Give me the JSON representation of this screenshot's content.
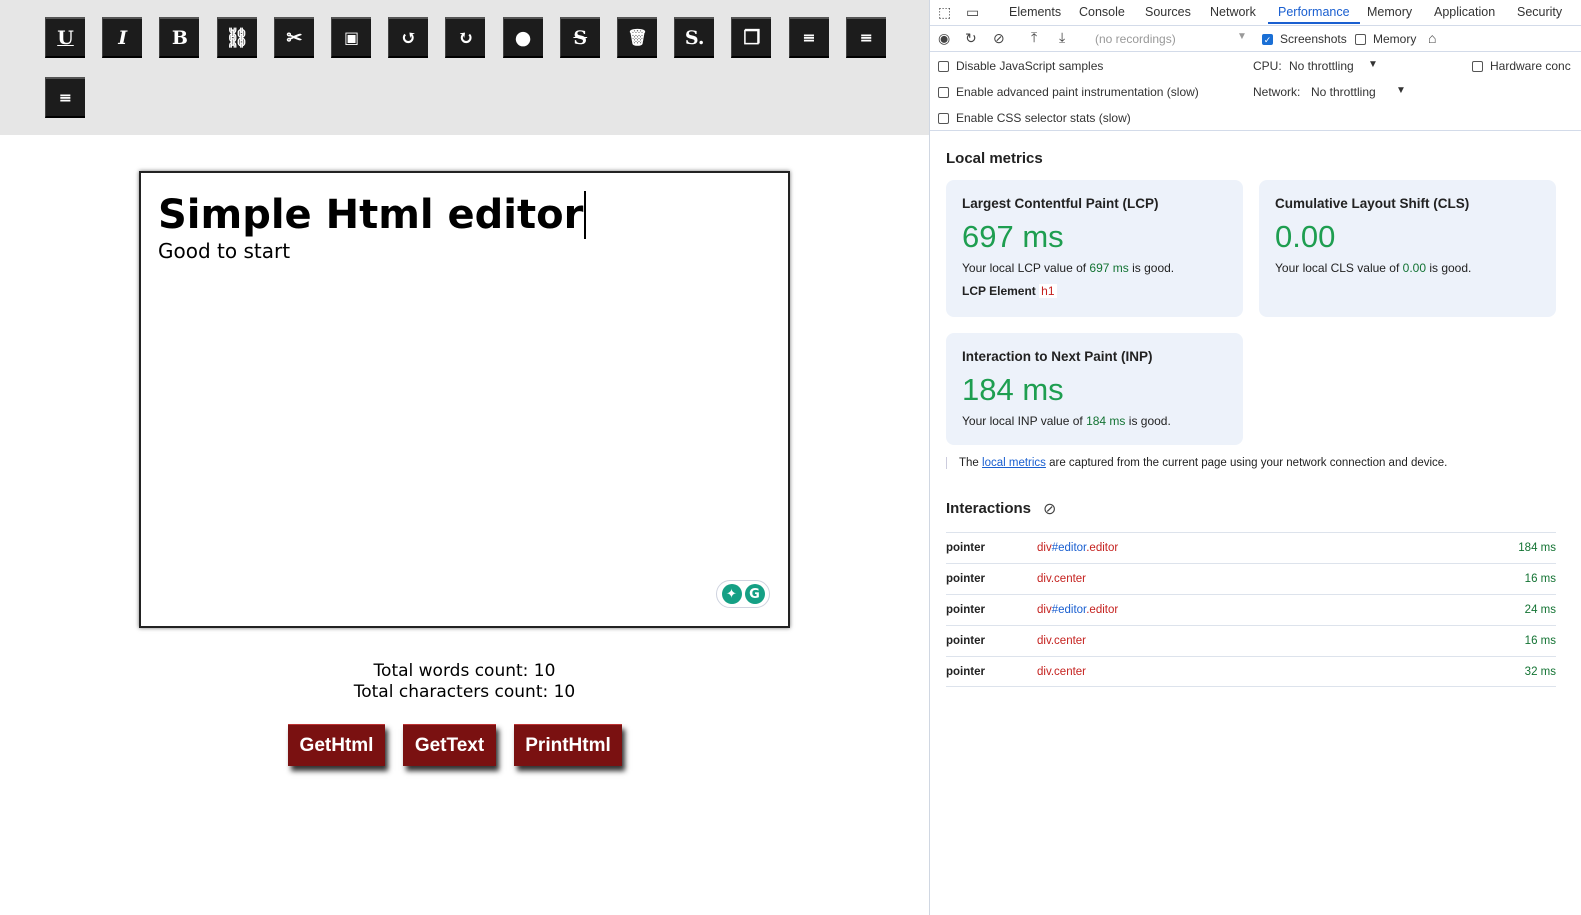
{
  "toolbar": {
    "buttons": [
      {
        "name": "underline",
        "glyph": "U"
      },
      {
        "name": "italic",
        "glyph": "I"
      },
      {
        "name": "bold",
        "glyph": "B"
      },
      {
        "name": "link",
        "glyph": "⛓"
      },
      {
        "name": "cut",
        "glyph": "✂"
      },
      {
        "name": "image",
        "glyph": "▣"
      },
      {
        "name": "undo",
        "glyph": "↺"
      },
      {
        "name": "redo",
        "glyph": "↻"
      },
      {
        "name": "color",
        "glyph": "●"
      },
      {
        "name": "strikethrough",
        "glyph": "S"
      },
      {
        "name": "delete",
        "glyph": "🗑"
      },
      {
        "name": "remove-format",
        "glyph": "S."
      },
      {
        "name": "copy",
        "glyph": "❐"
      },
      {
        "name": "align-center",
        "glyph": "≡"
      },
      {
        "name": "align-left",
        "glyph": "≡"
      },
      {
        "name": "align-right",
        "glyph": "≡"
      }
    ]
  },
  "editor": {
    "heading": "Simple Html editor",
    "paragraph": "Good to start"
  },
  "counts": {
    "words": "Total words count: 10",
    "chars": "Total characters count: 10"
  },
  "actions": {
    "get_html": "GetHtml",
    "get_text": "GetText",
    "print_html": "PrintHtml"
  },
  "devtools": {
    "tabs": [
      "Elements",
      "Console",
      "Sources",
      "Network",
      "Performance",
      "Memory",
      "Application",
      "Security"
    ],
    "active_tab": "Performance",
    "recordings_placeholder": "(no recordings)",
    "screenshots_label": "Screenshots",
    "memory_label": "Memory",
    "settings": {
      "disable_js": "Disable JavaScript samples",
      "adv_paint": "Enable advanced paint instrumentation (slow)",
      "css_stats": "Enable CSS selector stats (slow)",
      "cpu_label": "CPU:",
      "cpu_value": "No throttling",
      "network_label": "Network:",
      "network_value": "No throttling",
      "hardware": "Hardware conc"
    },
    "local_metrics": {
      "title": "Local metrics",
      "lcp": {
        "title": "Largest Contentful Paint (LCP)",
        "value": "697 ms",
        "desc_pre": "Your local LCP value of ",
        "desc_val": "697 ms",
        "desc_post": " is good.",
        "element_label": "LCP Element",
        "element": "h1"
      },
      "cls": {
        "title": "Cumulative Layout Shift (CLS)",
        "value": "0.00",
        "desc_pre": "Your local CLS value of ",
        "desc_val": "0.00",
        "desc_post": " is good."
      },
      "inp": {
        "title": "Interaction to Next Paint (INP)",
        "value": "184 ms",
        "desc_pre": "Your local INP value of ",
        "desc_val": "184 ms",
        "desc_post": " is good."
      },
      "note_pre": "The ",
      "note_link": "local metrics",
      "note_post": " are captured from the current page using your network connection and device."
    },
    "interactions": {
      "title": "Interactions",
      "rows": [
        {
          "type": "pointer",
          "tag": "div",
          "id": "#editor",
          "cls": ".editor",
          "time": "184 ms"
        },
        {
          "type": "pointer",
          "tag": "div.center",
          "id": "",
          "cls": "",
          "time": "16 ms"
        },
        {
          "type": "pointer",
          "tag": "div",
          "id": "#editor",
          "cls": ".editor",
          "time": "24 ms"
        },
        {
          "type": "pointer",
          "tag": "div.center",
          "id": "",
          "cls": "",
          "time": "16 ms"
        },
        {
          "type": "pointer",
          "tag": "div.center",
          "id": "",
          "cls": "",
          "time": "32 ms"
        }
      ]
    }
  }
}
